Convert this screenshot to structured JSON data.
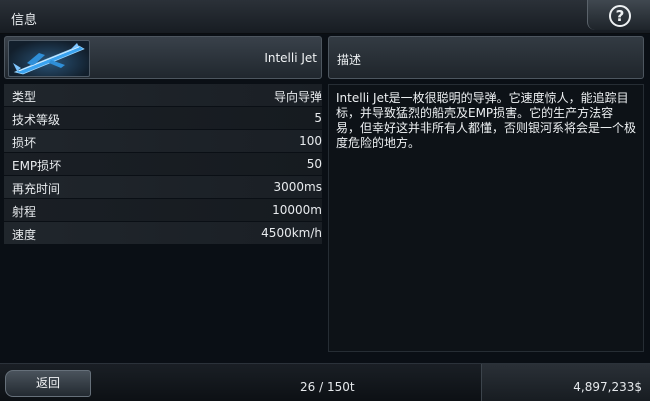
{
  "window": {
    "title": "信息"
  },
  "item": {
    "name": "Intelli Jet"
  },
  "stats": [
    {
      "label": "类型",
      "value": "导向导弹"
    },
    {
      "label": "技术等级",
      "value": "5"
    },
    {
      "label": "损坏",
      "value": "100"
    },
    {
      "label": "EMP损坏",
      "value": "50"
    },
    {
      "label": "再充时间",
      "value": "3000ms"
    },
    {
      "label": "射程",
      "value": "10000m"
    },
    {
      "label": "速度",
      "value": "4500km/h"
    }
  ],
  "description": {
    "header": "描述",
    "text": "Intelli Jet是一枚很聪明的导弹。它速度惊人，能追踪目标，并导致猛烈的船壳及EMP损害。它的生产方法容易，但幸好这并非所有人都懂，否则银河系将会是一个极度危险的地方。"
  },
  "footer": {
    "back_label": "返回",
    "cargo": "26 / 150t",
    "money": "4,897,233$"
  },
  "colors": {
    "accent": "#2f8fd8",
    "panel": "#20272e",
    "background": "#0a0f15"
  },
  "icons": {
    "help": "question-circle-icon",
    "item": "missile-thumbnail"
  }
}
